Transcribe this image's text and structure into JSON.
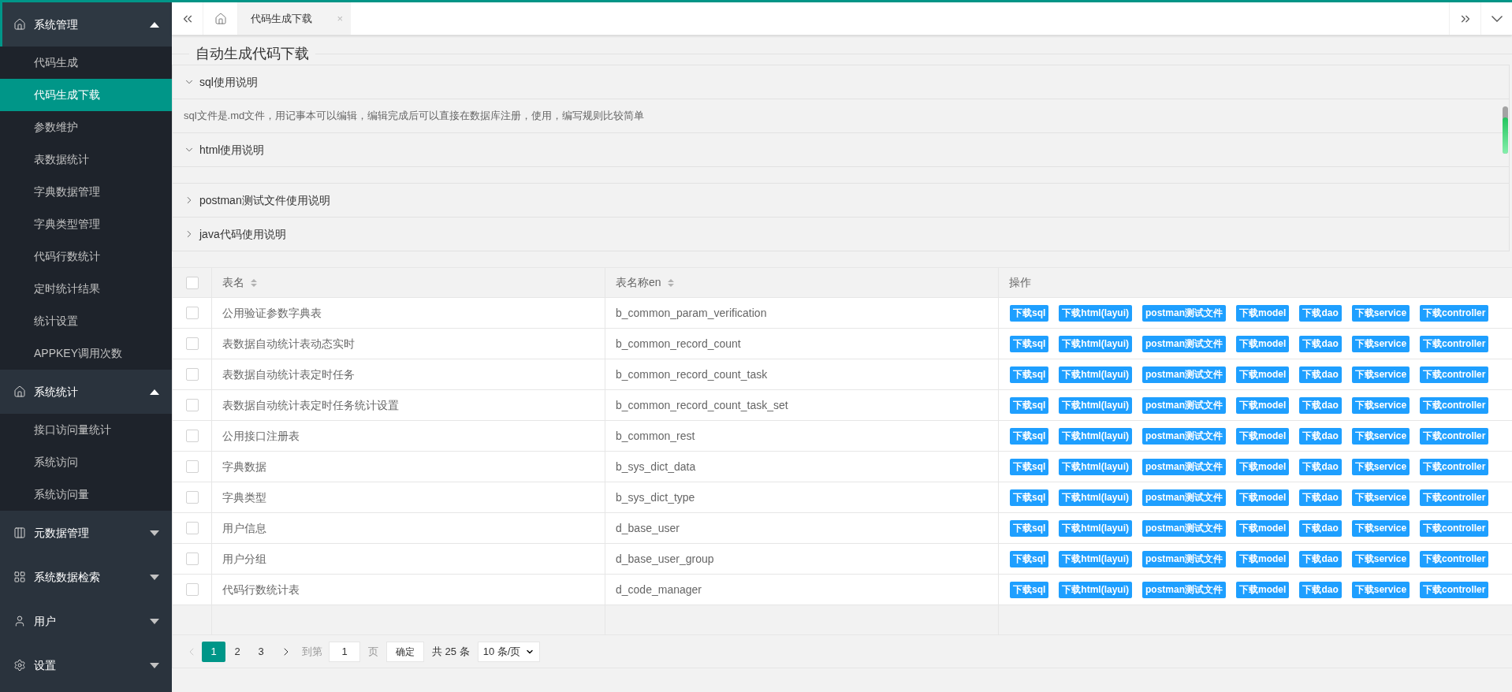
{
  "sidebar": {
    "groups": [
      {
        "label": "系统管理",
        "selected": true,
        "expanded": true,
        "items": [
          {
            "label": "代码生成",
            "selected": false
          },
          {
            "label": "代码生成下载",
            "selected": true
          },
          {
            "label": "参数维护",
            "selected": false
          },
          {
            "label": "表数据统计",
            "selected": false
          },
          {
            "label": "字典数据管理",
            "selected": false
          },
          {
            "label": "字典类型管理",
            "selected": false
          },
          {
            "label": "代码行数统计",
            "selected": false
          },
          {
            "label": "定时统计结果",
            "selected": false
          },
          {
            "label": "统计设置",
            "selected": false
          },
          {
            "label": "APPKEY调用次数",
            "selected": false
          }
        ]
      },
      {
        "label": "系统统计",
        "selected": false,
        "expanded": true,
        "items": [
          {
            "label": "接口访问量统计",
            "selected": false
          },
          {
            "label": "系统访问",
            "selected": false
          },
          {
            "label": "系统访问量",
            "selected": false
          }
        ]
      },
      {
        "label": "元数据管理",
        "selected": false,
        "expanded": false
      },
      {
        "label": "系统数据检索",
        "selected": false,
        "expanded": false
      },
      {
        "label": "用户",
        "selected": false,
        "expanded": false
      },
      {
        "label": "设置",
        "selected": false,
        "expanded": false
      }
    ]
  },
  "tabs": [
    {
      "label": "代码生成下载",
      "selected": true,
      "close": "×"
    }
  ],
  "page_title": "自动生成代码下载",
  "accordion": [
    {
      "title": "sql使用说明",
      "expanded": true,
      "content": "sql文件是.md文件，用记事本可以编辑，编辑完成后可以直接在数据库注册，使用，编写规则比较简单"
    },
    {
      "title": "html使用说明",
      "expanded": true
    },
    {
      "title": "postman测试文件使用说明",
      "expanded": false
    },
    {
      "title": "java代码使用说明",
      "expanded": false
    }
  ],
  "table": {
    "select_all_checked": false,
    "columns": [
      {
        "label": "表名",
        "sortable": true
      },
      {
        "label": "表名称en",
        "sortable": true
      },
      {
        "label": "操作",
        "sortable": false
      }
    ],
    "rows": [
      {
        "checked": false,
        "name": "公用验证参数字典表",
        "name_en": "b_common_param_verification",
        "actions": [
          "下载sql",
          "下载html(layui)",
          "postman测试文件",
          "下载model",
          "下载dao",
          "下载service",
          "下载controller"
        ]
      },
      {
        "checked": false,
        "name": "表数据自动统计表动态实时",
        "name_en": "b_common_record_count",
        "actions": [
          "下载sql",
          "下载html(layui)",
          "postman测试文件",
          "下载model",
          "下载dao",
          "下载service",
          "下载controller"
        ]
      },
      {
        "checked": false,
        "name": "表数据自动统计表定时任务",
        "name_en": "b_common_record_count_task",
        "actions": [
          "下载sql",
          "下载html(layui)",
          "postman测试文件",
          "下载model",
          "下载dao",
          "下载service",
          "下载controller"
        ]
      },
      {
        "checked": false,
        "name": "表数据自动统计表定时任务统计设置",
        "name_en": "b_common_record_count_task_set",
        "actions": [
          "下载sql",
          "下载html(layui)",
          "postman测试文件",
          "下载model",
          "下载dao",
          "下载service",
          "下载controller"
        ]
      },
      {
        "checked": false,
        "name": "公用接口注册表",
        "name_en": "b_common_rest",
        "actions": [
          "下载sql",
          "下载html(layui)",
          "postman测试文件",
          "下载model",
          "下载dao",
          "下载service",
          "下载controller"
        ]
      },
      {
        "checked": false,
        "name": "字典数据",
        "name_en": "b_sys_dict_data",
        "actions": [
          "下载sql",
          "下载html(layui)",
          "postman测试文件",
          "下载model",
          "下载dao",
          "下载service",
          "下载controller"
        ]
      },
      {
        "checked": false,
        "name": "字典类型",
        "name_en": "b_sys_dict_type",
        "actions": [
          "下载sql",
          "下载html(layui)",
          "postman测试文件",
          "下载model",
          "下载dao",
          "下载service",
          "下载controller"
        ]
      },
      {
        "checked": false,
        "name": "用户信息",
        "name_en": "d_base_user",
        "actions": [
          "下载sql",
          "下载html(layui)",
          "postman测试文件",
          "下载model",
          "下载dao",
          "下载service",
          "下载controller"
        ]
      },
      {
        "checked": false,
        "name": "用户分组",
        "name_en": "d_base_user_group",
        "actions": [
          "下载sql",
          "下载html(layui)",
          "postman测试文件",
          "下载model",
          "下载dao",
          "下载service",
          "下载controller"
        ]
      },
      {
        "checked": false,
        "name": "代码行数统计表",
        "name_en": "d_code_manager",
        "actions": [
          "下载sql",
          "下载html(layui)",
          "postman测试文件",
          "下载model",
          "下载dao",
          "下载service",
          "下载controller"
        ]
      }
    ]
  },
  "pagination": {
    "prev_disabled": true,
    "next_disabled": false,
    "pages": [
      {
        "label": "1",
        "selected": true
      },
      {
        "label": "2",
        "selected": false
      },
      {
        "label": "3",
        "selected": false
      }
    ],
    "goto_label": "到第",
    "goto_value": "1",
    "page_unit": "页",
    "confirm": "确定",
    "total": "共 25 条",
    "page_size": "10 条/页"
  }
}
